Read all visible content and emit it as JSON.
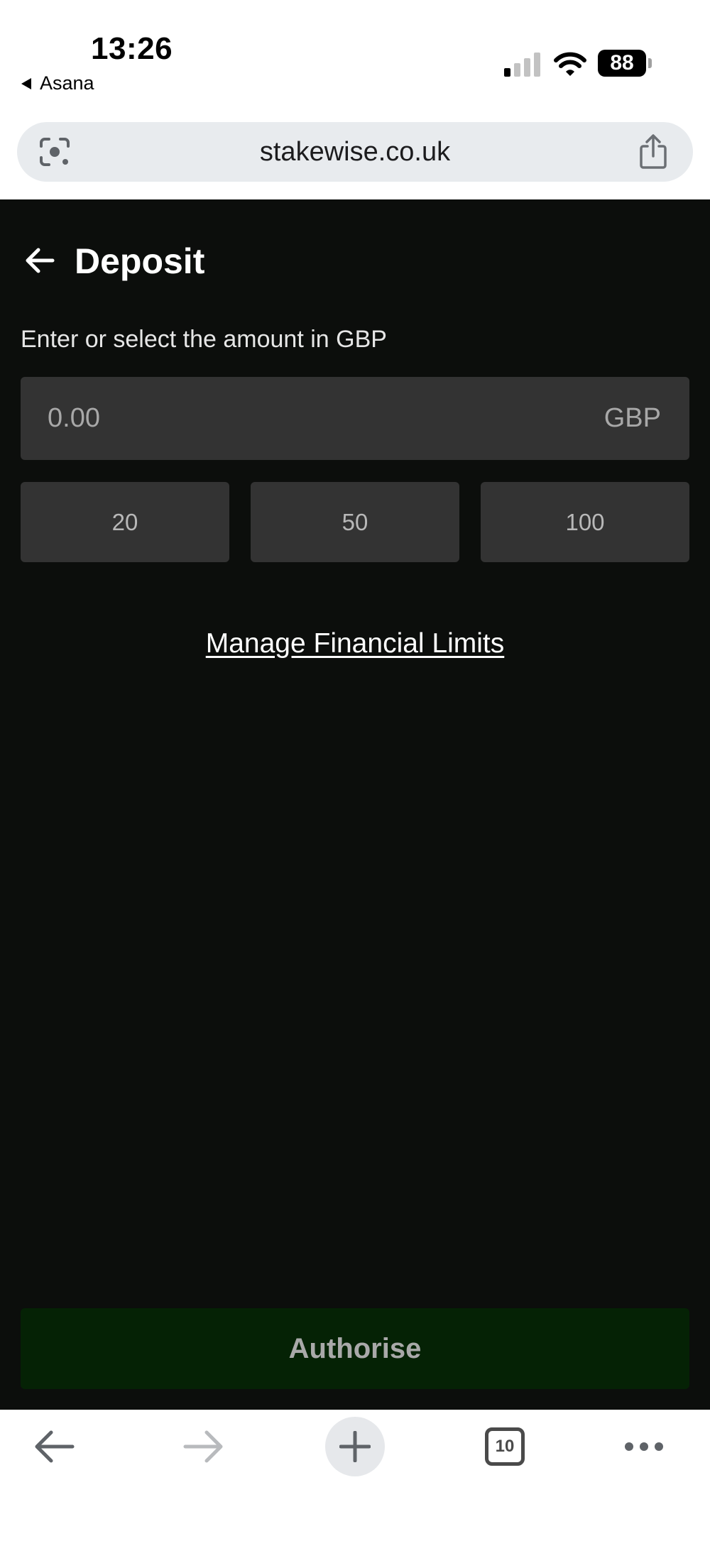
{
  "status_bar": {
    "time": "13:26",
    "back_app": "Asana",
    "battery": "88"
  },
  "browser": {
    "url": "stakewise.co.uk",
    "open_tabs": "10"
  },
  "deposit": {
    "title": "Deposit",
    "instruction": "Enter or select the amount in GBP",
    "amount_placeholder": "0.00",
    "currency": "GBP",
    "quick_amounts": [
      "20",
      "50",
      "100"
    ],
    "manage_limits": "Manage Financial Limits",
    "authorise": "Authorise"
  },
  "colors": {
    "background": "#0c0e0c",
    "field": "#333333",
    "authorise_button": "#052205"
  },
  "icons": {
    "back": "arrow-left-icon",
    "lens": "google-lens-icon",
    "share": "share-icon",
    "new_tab": "plus-icon",
    "more": "more-dots-icon"
  }
}
